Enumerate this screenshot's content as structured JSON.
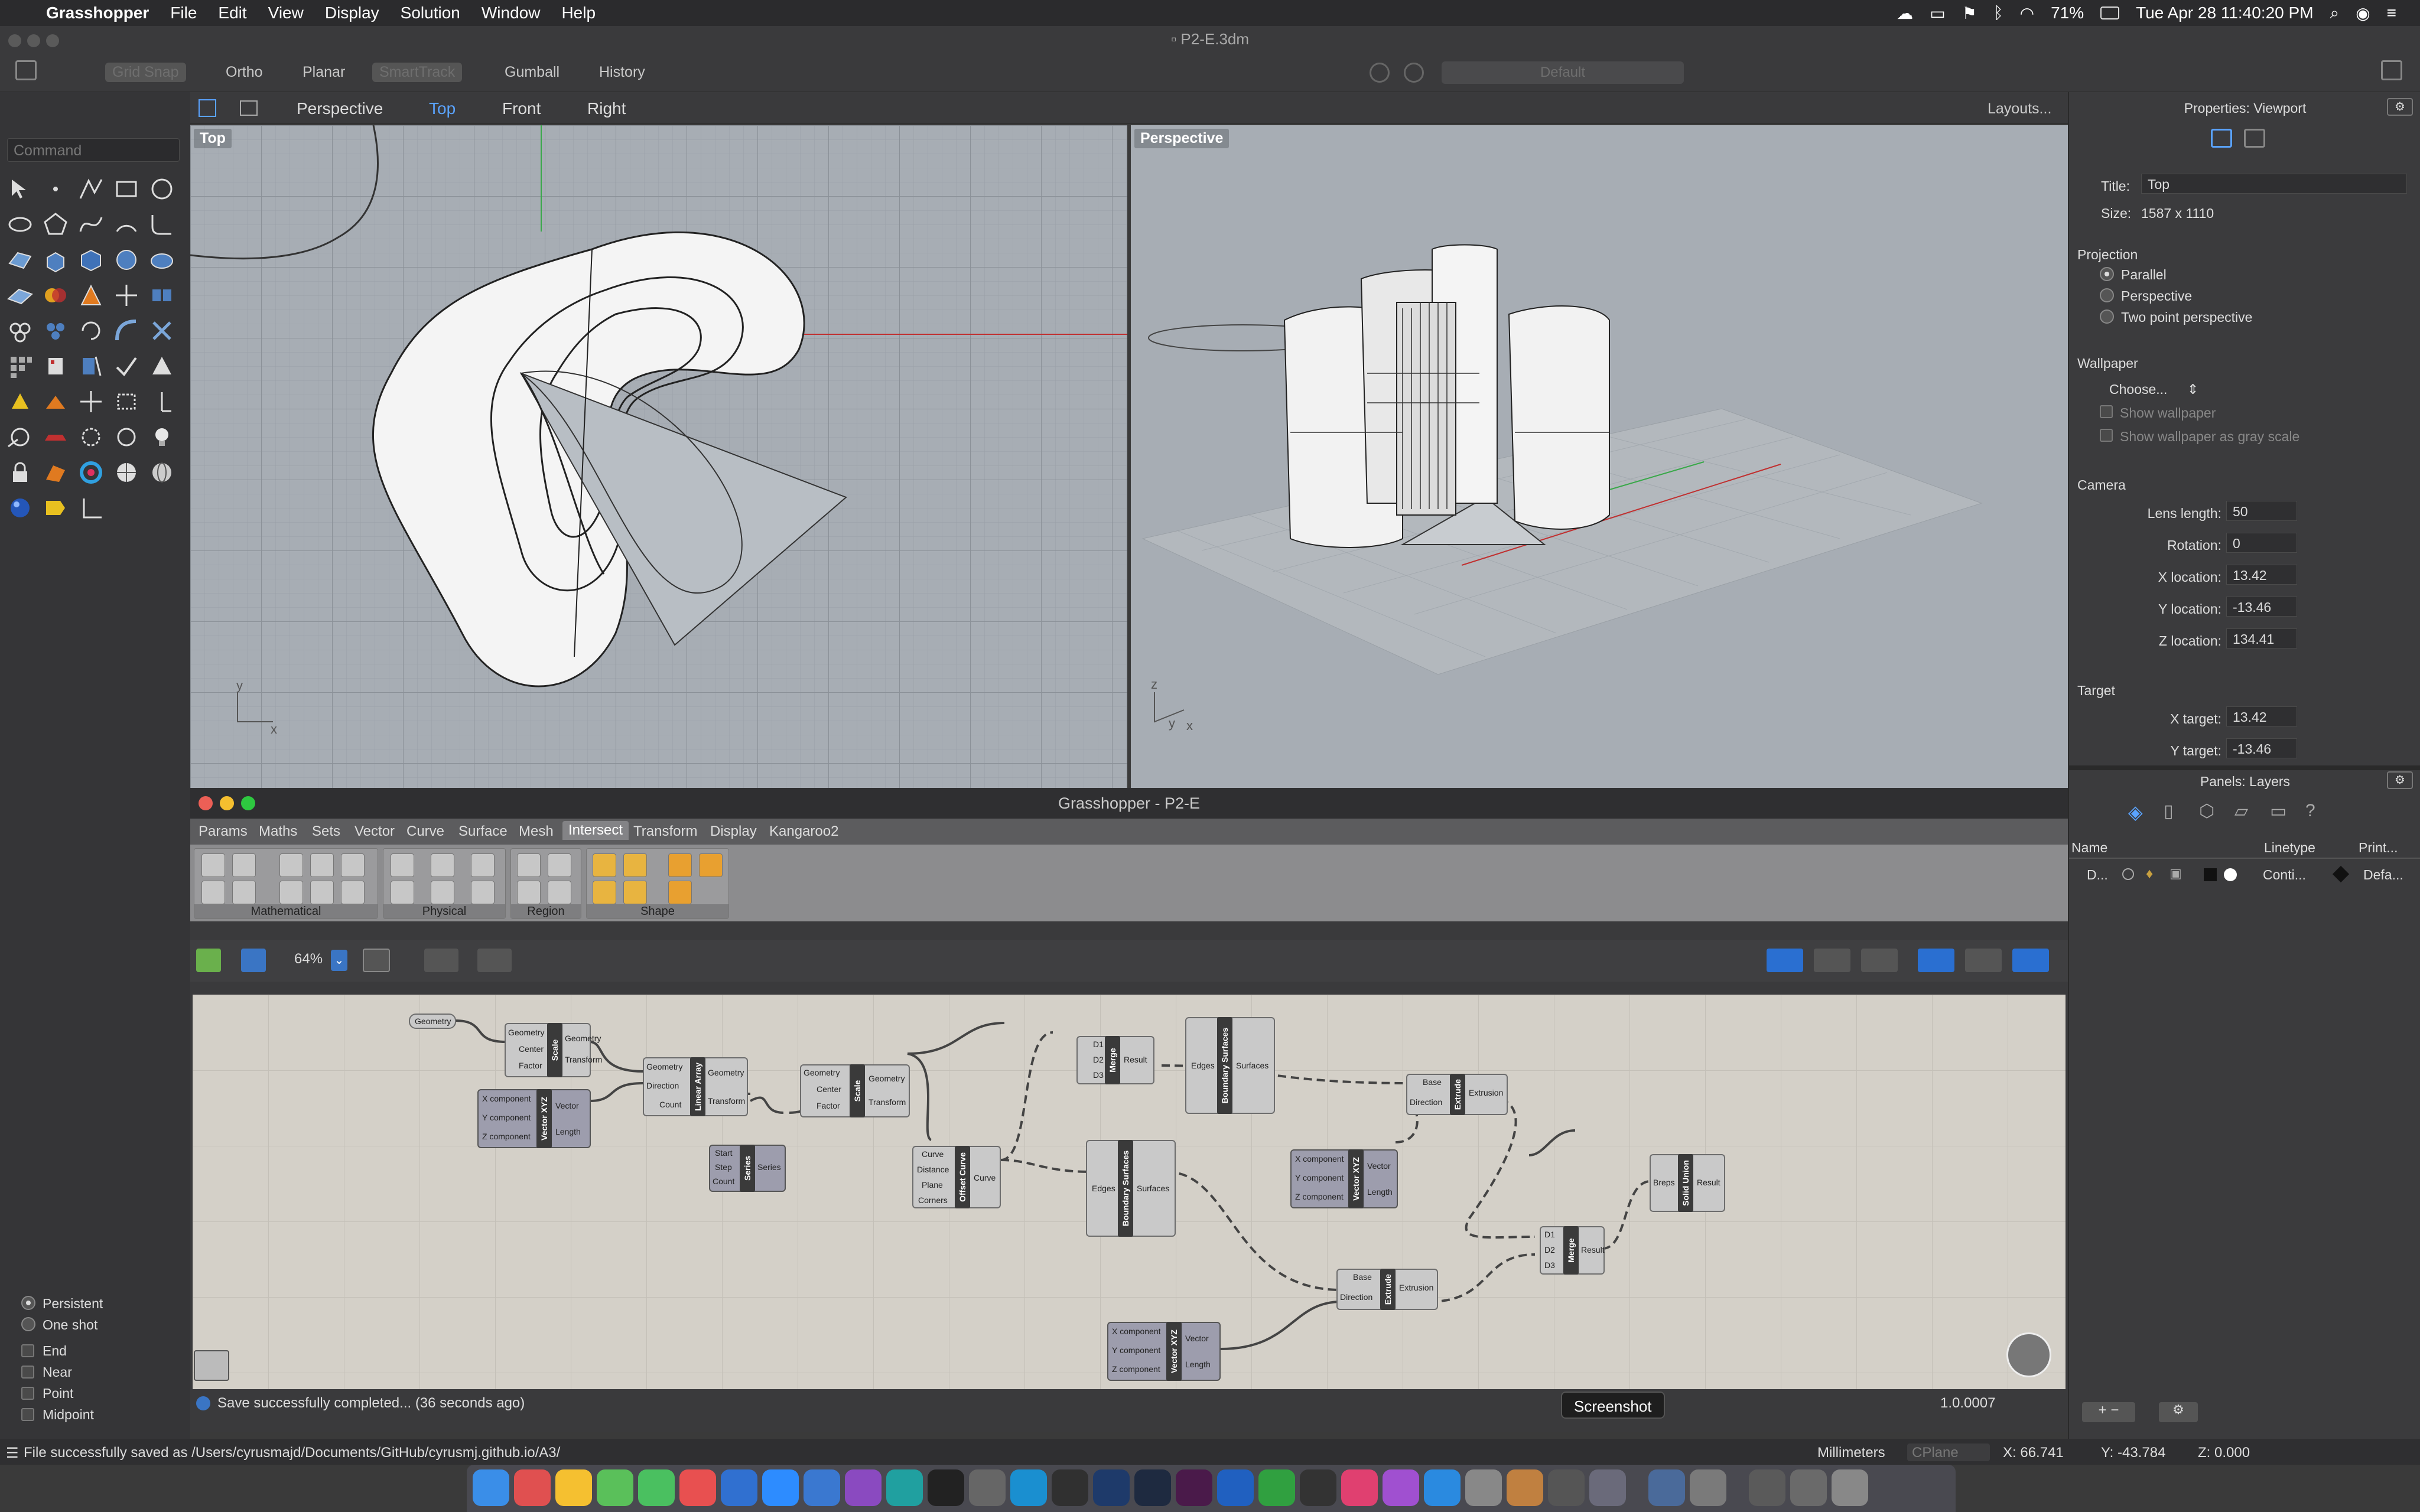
{
  "menubar": {
    "app": "Grasshopper",
    "items": [
      "File",
      "Edit",
      "View",
      "Display",
      "Solution",
      "Window",
      "Help"
    ],
    "battery": "71%",
    "clock": "Tue Apr 28  11:40:20 PM"
  },
  "window": {
    "title": "P2-E.3dm"
  },
  "toolbar": {
    "grid_snap": "Grid Snap",
    "ortho": "Ortho",
    "planar": "Planar",
    "smarttrack": "SmartTrack",
    "gumball": "Gumball",
    "history": "History",
    "layer_default": "Default"
  },
  "viewport_tabs": [
    "Perspective",
    "Top",
    "Front",
    "Right"
  ],
  "layouts": "Layouts...",
  "command_placeholder": "Command",
  "viewports": {
    "top_label": "Top",
    "perspective_label": "Perspective"
  },
  "osnap": {
    "persistent": "Persistent",
    "one_shot": "One shot",
    "items": [
      "End",
      "Near",
      "Point",
      "Midpoint"
    ]
  },
  "properties": {
    "header": "Properties: Viewport",
    "title_label": "Title:",
    "title_value": "Top",
    "size_label": "Size:",
    "size_value": "1587 x 1110",
    "projection": "Projection",
    "proj_options": [
      "Parallel",
      "Perspective",
      "Two point perspective"
    ],
    "wallpaper": "Wallpaper",
    "choose": "Choose...",
    "show_wallpaper": "Show wallpaper",
    "show_gray": "Show wallpaper as gray scale",
    "camera": "Camera",
    "lens_label": "Lens length:",
    "lens": "50",
    "rotation_label": "Rotation:",
    "rotation": "0",
    "xloc_label": "X location:",
    "xloc": "13.42",
    "yloc_label": "Y location:",
    "yloc": "-13.46",
    "zloc_label": "Z location:",
    "zloc": "134.41",
    "target": "Target",
    "xt_label": "X target:",
    "xt": "13.42",
    "yt_label": "Y target:",
    "yt": "-13.46"
  },
  "layers": {
    "header": "Panels: Layers",
    "col_name": "Name",
    "col_linetype": "Linetype",
    "col_print": "Print...",
    "row_name": "D...",
    "row_linetype": "Conti...",
    "row_print": "Defa..."
  },
  "grasshopper": {
    "title": "Grasshopper - P2-E",
    "tabs": [
      "Params",
      "Maths",
      "Sets",
      "Vector",
      "Curve",
      "Surface",
      "Mesh",
      "Intersect",
      "Transform",
      "Display",
      "Kangaroo2"
    ],
    "active_tab": "Intersect",
    "groups": [
      "Mathematical",
      "Physical",
      "Region",
      "Shape"
    ],
    "zoom": "64%",
    "status": "Save successfully completed... (36 seconds ago)",
    "version": "1.0.0007",
    "tooltip": "Screenshot"
  },
  "components": {
    "geometry_param": "Geometry",
    "scale": "Scale",
    "linear_array": "Linear Array",
    "vector_xyz": "Vector XYZ",
    "series": "Series",
    "offset_curve": "Offset Curve",
    "merge": "Merge",
    "boundary_surfaces": "Boundary Surfaces",
    "extrude": "Extrude",
    "solid_union": "Solid Union",
    "pins": {
      "geometry": "Geometry",
      "center": "Center",
      "factor": "Factor",
      "transform": "Transform",
      "direction": "Direction",
      "count": "Count",
      "x": "X component",
      "y": "Y component",
      "z": "Z component",
      "vector": "Vector",
      "length": "Length",
      "start": "Start",
      "step": "Step",
      "series": "Series",
      "curve": "Curve",
      "distance": "Distance",
      "plane": "Plane",
      "corners": "Corners",
      "d1": "D1",
      "d2": "D2",
      "d3": "D3",
      "result": "Result",
      "edges": "Edges",
      "surfaces": "Surfaces",
      "base": "Base",
      "extrusion": "Extrusion",
      "breps": "Breps"
    }
  },
  "statusbar": {
    "saved": "File successfully saved as /Users/cyrusmajd/Documents/GitHub/cyrusmj.github.io/A3/",
    "units": "Millimeters",
    "cplane": "CPlane",
    "x": "X: 66.741",
    "y": "Y: -43.784",
    "z": "Z: 0.000"
  }
}
